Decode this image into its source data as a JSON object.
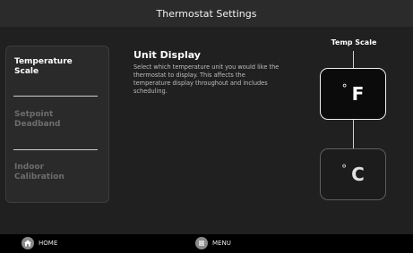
{
  "header": {
    "title": "Thermostat Settings"
  },
  "sidebar": {
    "items": [
      {
        "label": "Temperature Scale",
        "active": true
      },
      {
        "label": "Setpoint Deadband",
        "active": false
      },
      {
        "label": "Indoor Calibration",
        "active": false
      }
    ]
  },
  "content": {
    "title": "Unit Display",
    "description": "Select which temperature unit you would like the thermostat to display. This affects the temperature display throughout and includes scheduling."
  },
  "scale": {
    "label": "Temp Scale",
    "fahrenheit": {
      "symbol": "°",
      "unit": "F",
      "selected": true
    },
    "celsius": {
      "symbol": "°",
      "unit": "C",
      "selected": false
    }
  },
  "footer": {
    "home_label": "HOME",
    "menu_label": "MENU"
  },
  "icons": {
    "home": "home-icon",
    "menu": "menu-icon"
  },
  "colors": {
    "background": "#202020",
    "titlebar": "#2b2b2b",
    "selected_border": "#f0f0f0",
    "unselected_border": "#5e5e5e",
    "dim_text": "#6d6d6d"
  }
}
